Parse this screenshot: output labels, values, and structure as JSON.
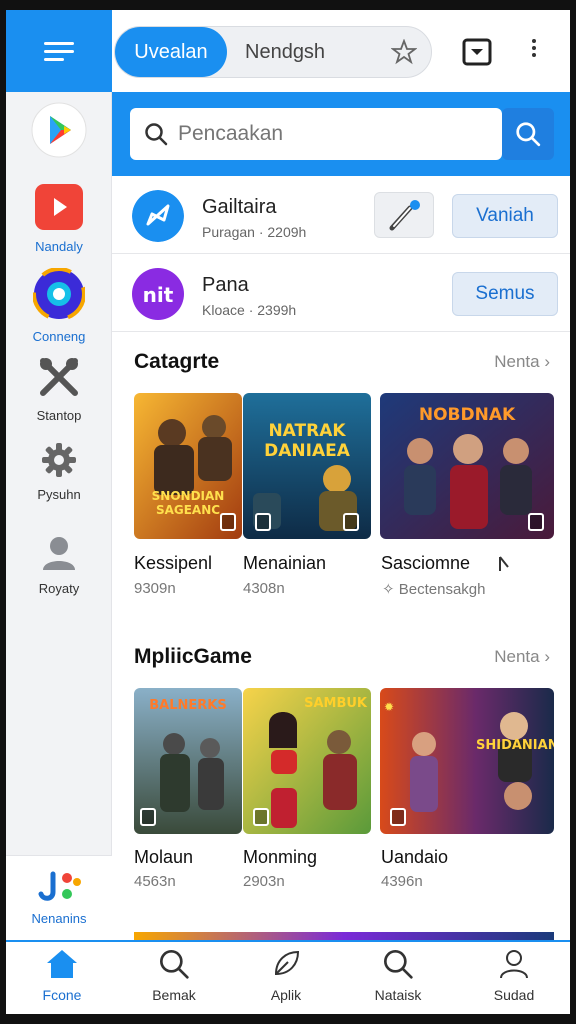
{
  "header": {
    "tab_active": "Uvealan",
    "tab_inactive": "Nendgsh"
  },
  "search": {
    "placeholder": "Pencaakan"
  },
  "rail": {
    "items": [
      {
        "label": "",
        "icon": "play-store-icon"
      },
      {
        "label": "Nandaly",
        "icon": "youtube-icon"
      },
      {
        "label": "Conneng",
        "icon": "circle-app-icon"
      },
      {
        "label": "Stantop",
        "icon": "tools-icon"
      },
      {
        "label": "Pysuhn",
        "icon": "gear-icon"
      },
      {
        "label": "Royaty",
        "icon": "person-icon"
      }
    ],
    "bottom_label": "Nenanins"
  },
  "apps": [
    {
      "title": "Gailtaira",
      "meta": "Puragan · 2209h",
      "button": "Vaniah",
      "icon_color": "#1a8ff0"
    },
    {
      "title": "Pana",
      "meta": "Kloace ·  2399h",
      "button": "Semus",
      "icon_color": "#8a2be2"
    }
  ],
  "sections": [
    {
      "title": "Catagrte",
      "more": "Nenta",
      "cards": [
        {
          "title": "Kessipenl",
          "meta": "9309n",
          "art": "SNONDIAN SAGEANC"
        },
        {
          "title": "Menainian",
          "meta": "4308n",
          "art": "NATRAK DANIAEA"
        },
        {
          "title": "Sasciomne",
          "meta": "Bectensakgh",
          "art": "NOBDNAK"
        }
      ]
    },
    {
      "title": "MpliicGame",
      "more": "Nenta",
      "cards": [
        {
          "title": "Molaun",
          "meta": "4563n",
          "art": "BALNERKS"
        },
        {
          "title": "Monming",
          "meta": "2903n",
          "art": "SAMBUK"
        },
        {
          "title": "Uandaio",
          "meta": "4396n",
          "art": "SHIDANIAN"
        }
      ]
    }
  ],
  "bottom_nav": [
    {
      "label": "Fcone",
      "icon": "home-icon"
    },
    {
      "label": "Bemak",
      "icon": "search-icon"
    },
    {
      "label": "Aplik",
      "icon": "leaf-icon"
    },
    {
      "label": "Nataisk",
      "icon": "search-icon"
    },
    {
      "label": "Sudad",
      "icon": "person-icon"
    }
  ],
  "colors": {
    "accent": "#1a8ff0",
    "button_text": "#1a6fd0"
  }
}
